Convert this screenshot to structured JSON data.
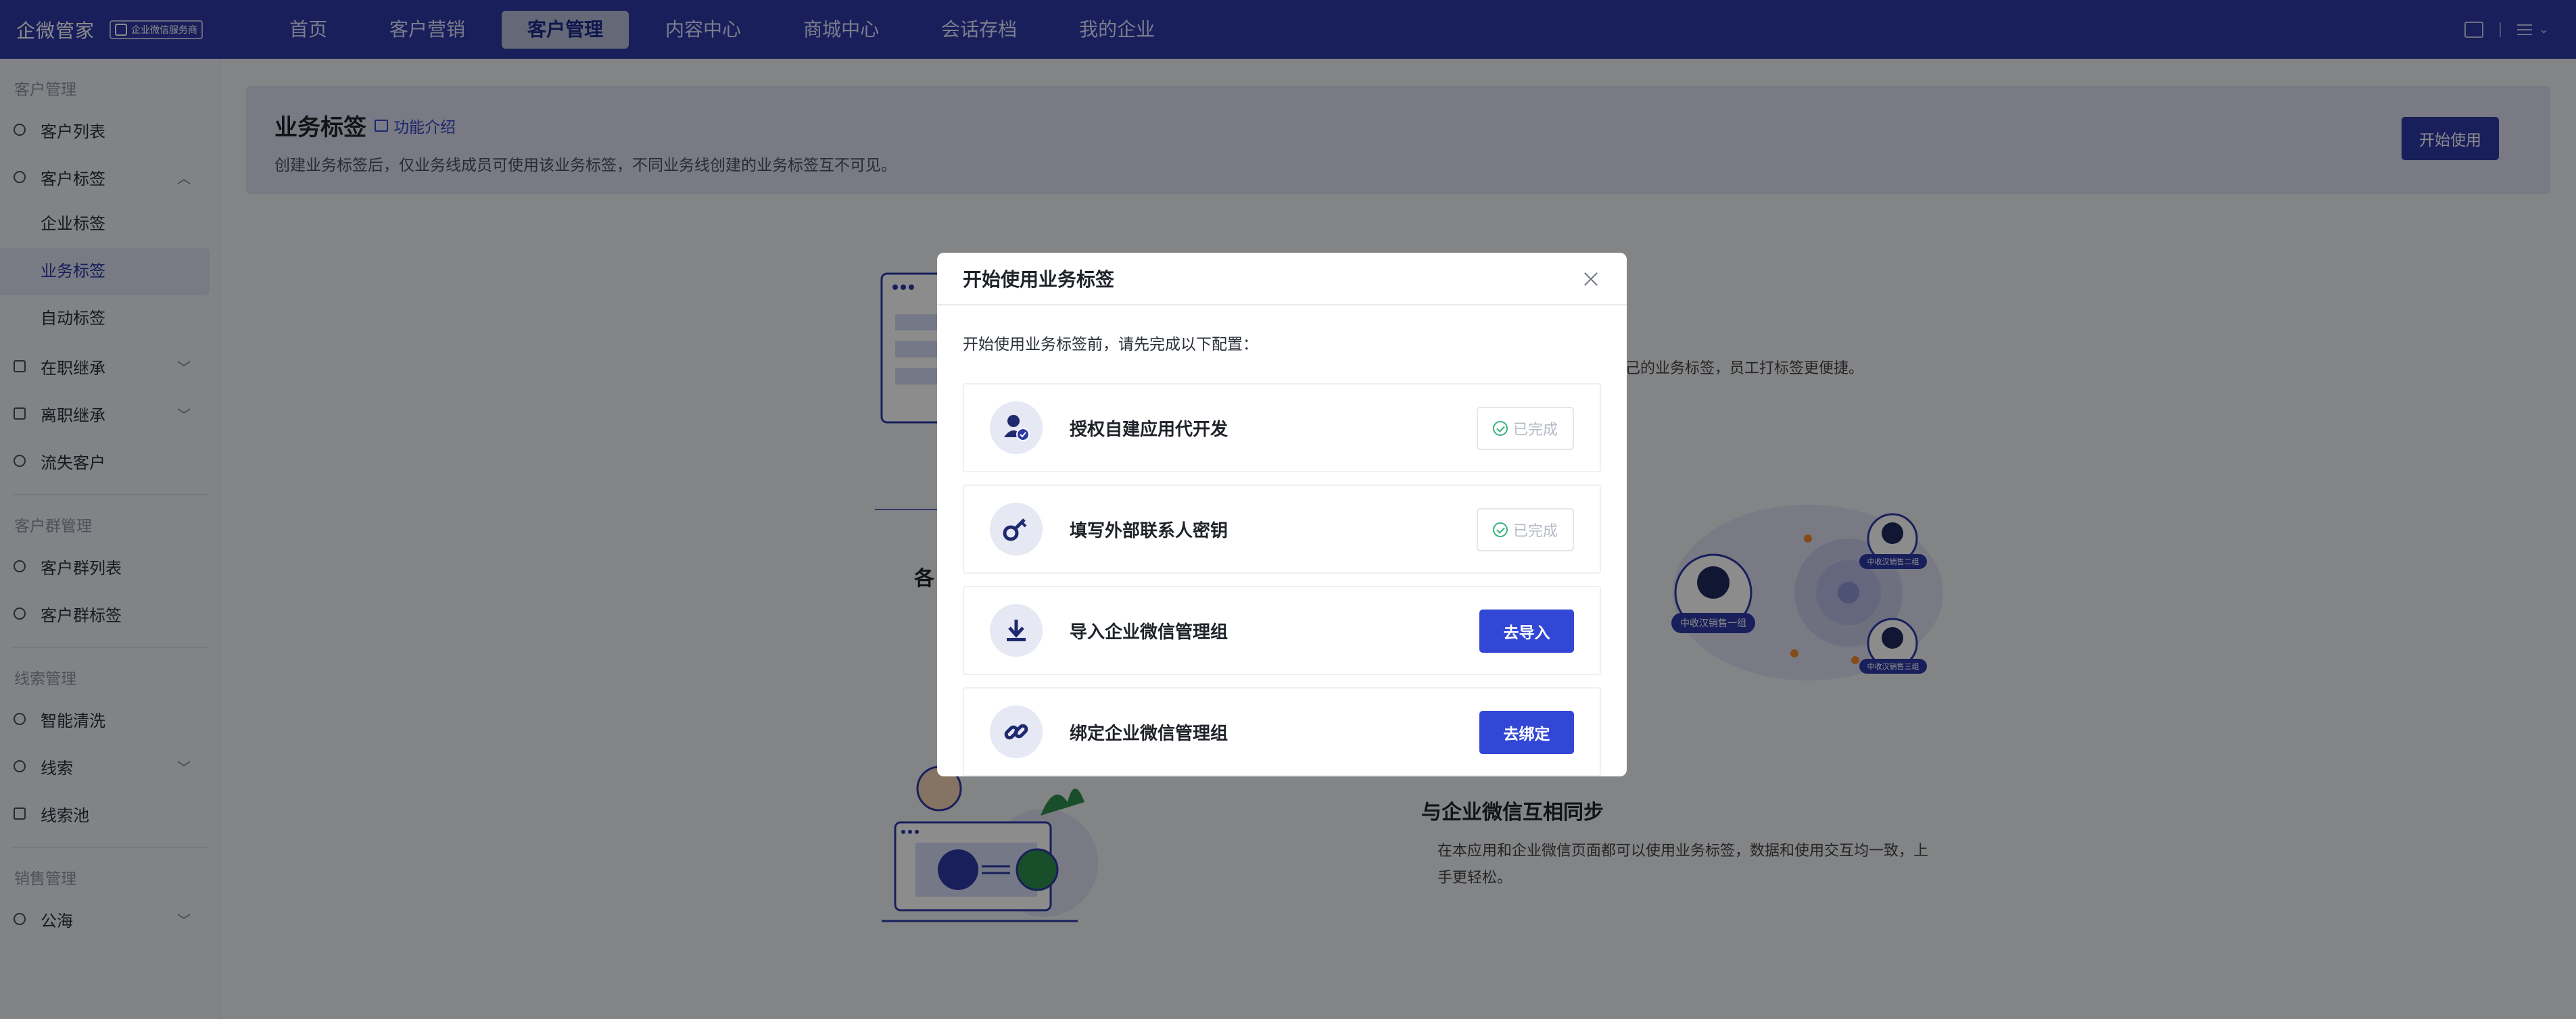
{
  "topbar": {
    "brand": "企微管家",
    "badge": "企业微信服务商",
    "nav": [
      {
        "label": "首页",
        "active": false
      },
      {
        "label": "客户营销",
        "active": false
      },
      {
        "label": "客户管理",
        "active": true
      },
      {
        "label": "内容中心",
        "active": false
      },
      {
        "label": "商城中心",
        "active": false
      },
      {
        "label": "会话存档",
        "active": false
      },
      {
        "label": "我的企业",
        "active": false
      }
    ]
  },
  "sidebar": {
    "group1": "客户管理",
    "customer_list": "客户列表",
    "customer_tags": "客户标签",
    "enterprise_tags": "企业标签",
    "business_tags": "业务标签",
    "auto_tags": "自动标签",
    "onjob_inherit": "在职继承",
    "resign_inherit": "离职继承",
    "lost_customers": "流失客户",
    "group2": "客户群管理",
    "group_list": "客户群列表",
    "group_tags": "客户群标签",
    "group3": "线索管理",
    "smart_clean": "智能清洗",
    "leads": "线索",
    "lead_pool": "线索池",
    "group4": "销售管理",
    "public_sea": "公海"
  },
  "banner": {
    "title": "业务标签",
    "link": "功能介绍",
    "desc": "创建业务标签后，仅业务线成员可使用该业务标签，不同业务线创建的业务标签互不可见。",
    "start_button": "开始使用"
  },
  "background": {
    "right_snippet": "自己的业务标签，员工打标签更便捷。",
    "left_heading_fragment": "各",
    "sync_heading": "与企业微信互相同步",
    "sync_desc_line1": "在本应用和企业微信页面都可以使用业务标签，数据和使用交互均一致，上",
    "sync_desc_line2": "手更轻松。",
    "chip_main": "中收汉销售一组",
    "chip_b1": "中收汉销售二组",
    "chip_b2": "中收汉销售三组"
  },
  "modal": {
    "title": "开始使用业务标签",
    "intro": "开始使用业务标签前，请先完成以下配置：",
    "steps": [
      {
        "label": "授权自建应用代开发",
        "status": "已完成",
        "icon": "user-check-icon"
      },
      {
        "label": "填写外部联系人密钥",
        "status": "已完成",
        "icon": "key-icon"
      },
      {
        "label": "导入企业微信管理组",
        "action": "去导入",
        "icon": "download-icon"
      },
      {
        "label": "绑定企业微信管理组",
        "action": "去绑定",
        "icon": "link-icon"
      }
    ]
  },
  "colors": {
    "topbar": "#2c3aa6",
    "primary_button": "#3347d6",
    "done_check": "#36b37e"
  }
}
